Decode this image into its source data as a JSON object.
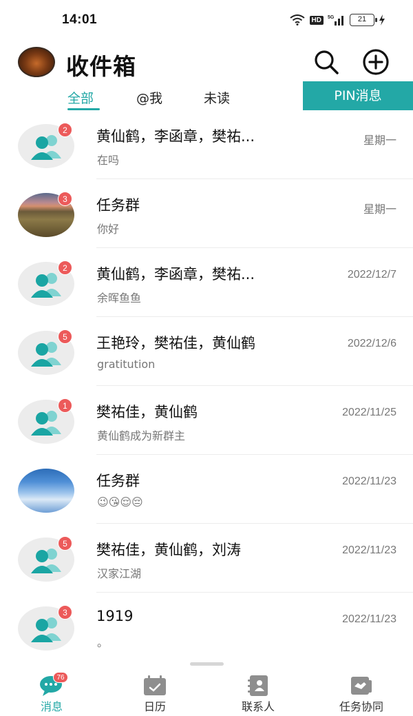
{
  "status_bar": {
    "time": "14:01",
    "hd_label": "HD",
    "signal_label": "5G",
    "battery": "21"
  },
  "header": {
    "title": "收件箱",
    "search_icon": "search-icon",
    "add_icon": "plus-circle-icon"
  },
  "tabs": {
    "all": "全部",
    "mentions": "@我",
    "unread": "未读",
    "pin": "PIN消息",
    "accent": "#23a8a6"
  },
  "chats": [
    {
      "name": "黄仙鹤，李函章，樊祐...",
      "preview": "在吗",
      "time": "星期一",
      "badge": "2",
      "avatar": "group"
    },
    {
      "name": "任务群",
      "preview": "你好",
      "time": "星期一",
      "badge": "3",
      "avatar": "photo-sunset"
    },
    {
      "name": "黄仙鹤，李函章，樊祐...",
      "preview": "余晖鱼鱼",
      "time": "2022/12/7",
      "badge": "2",
      "avatar": "group"
    },
    {
      "name": "王艳玲，樊祐佳，黄仙鹤",
      "preview": "gratitution",
      "time": "2022/12/6",
      "badge": "5",
      "avatar": "group"
    },
    {
      "name": "樊祐佳，黄仙鹤",
      "preview": "黄仙鹤成为新群主",
      "time": "2022/11/25",
      "badge": "1",
      "avatar": "group"
    },
    {
      "name": "任务群",
      "preview": "😉😘😌😔",
      "time": "2022/11/23",
      "badge": "",
      "avatar": "photo-sky"
    },
    {
      "name": "樊祐佳，黄仙鹤，刘涛",
      "preview": "汉家江湖",
      "time": "2022/11/23",
      "badge": "5",
      "avatar": "group"
    },
    {
      "name": "1919",
      "preview": "。",
      "time": "2022/11/23",
      "badge": "3",
      "avatar": "group"
    }
  ],
  "bottom_nav": {
    "messages": {
      "label": "消息",
      "badge": "76",
      "icon": "chat-bubble-icon"
    },
    "calendar": {
      "label": "日历",
      "icon": "calendar-icon"
    },
    "contacts": {
      "label": "联系人",
      "icon": "contacts-book-icon"
    },
    "tasks": {
      "label": "任务协同",
      "icon": "task-handshake-icon"
    }
  }
}
